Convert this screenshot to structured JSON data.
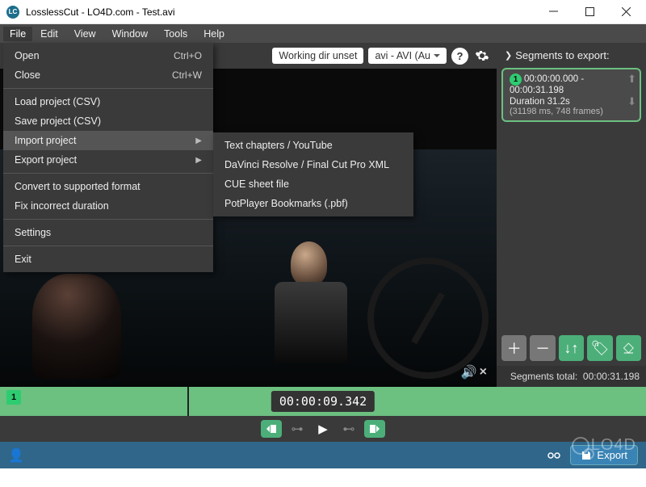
{
  "window": {
    "title": "LosslessCut - LO4D.com - Test.avi"
  },
  "menubar": {
    "file": "File",
    "edit": "Edit",
    "view": "View",
    "window": "Window",
    "tools": "Tools",
    "help": "Help"
  },
  "fileMenu": {
    "open": {
      "label": "Open",
      "shortcut": "Ctrl+O"
    },
    "close": {
      "label": "Close",
      "shortcut": "Ctrl+W"
    },
    "loadProject": "Load project (CSV)",
    "saveProject": "Save project (CSV)",
    "importProject": "Import project",
    "exportProject": "Export project",
    "convert": "Convert to supported format",
    "fixDuration": "Fix incorrect duration",
    "settings": "Settings",
    "exit": "Exit"
  },
  "importSubmenu": {
    "textChapters": "Text chapters / YouTube",
    "davinci": "DaVinci Resolve / Final Cut Pro XML",
    "cue": "CUE sheet file",
    "potplayer": "PotPlayer Bookmarks (.pbf)"
  },
  "toolbar": {
    "workingDir": "Working dir unset",
    "format": "avi - AVI (Au",
    "help": "?"
  },
  "segments": {
    "header": "Segments to export:",
    "item": {
      "index": "1",
      "range": "00:00:00.000 - 00:00:31.198",
      "duration": "Duration 31.2s",
      "frames": "(31198 ms, 748 frames)"
    },
    "totalLabel": "Segments total:",
    "totalValue": "00:00:31.198"
  },
  "timeline": {
    "badge": "1",
    "timecode": "00:00:09.342"
  },
  "bottom": {
    "export": "Export"
  },
  "watermark": "LO4D"
}
